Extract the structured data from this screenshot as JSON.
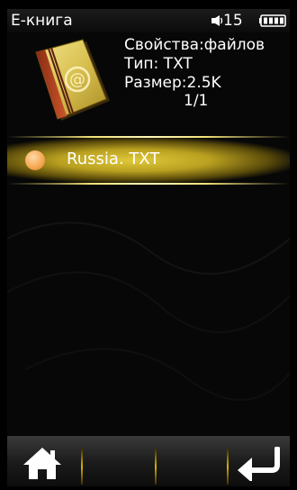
{
  "status_bar": {
    "title": "Е-книга",
    "volume_level": "15",
    "volume_icon": "speaker-icon",
    "battery_icon": "battery-icon"
  },
  "file_info": {
    "book_icon": "address-book-icon",
    "properties_label": "Свойства:файлов",
    "type_line": "Тип: TXT",
    "size_line": "Размер:2.5K",
    "page_counter": "1/1"
  },
  "file_list": {
    "items": [
      {
        "label": "Russia. TXT",
        "selected": true
      }
    ]
  },
  "bottom_bar": {
    "home_icon": "home-icon",
    "back_icon": "return-arrow-icon"
  },
  "colors": {
    "selection": "#c9b02a",
    "bullet": "#f4a650",
    "separator": "#d9b200"
  }
}
